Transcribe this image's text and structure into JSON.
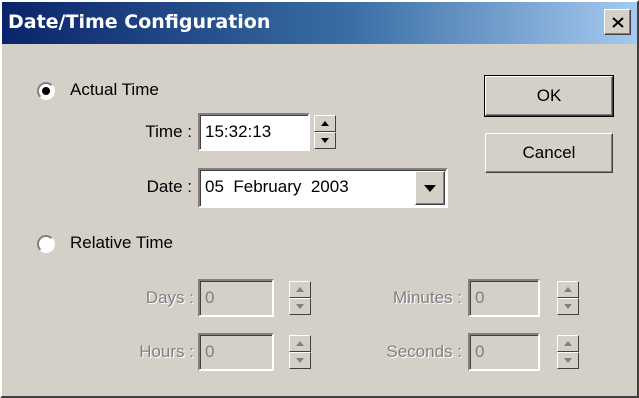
{
  "window": {
    "title": "Date/Time Configuration",
    "close_glyph": "✕"
  },
  "buttons": {
    "ok": "OK",
    "cancel": "Cancel"
  },
  "actual": {
    "label": "Actual Time",
    "selected": true,
    "time_label": "Time :",
    "time_value": "15:32:13",
    "date_label": "Date :",
    "date_value": "05  February  2003"
  },
  "relative": {
    "label": "Relative Time",
    "selected": false,
    "days_label": "Days :",
    "days_value": "0",
    "hours_label": "Hours :",
    "hours_value": "0",
    "minutes_label": "Minutes :",
    "minutes_value": "0",
    "seconds_label": "Seconds :",
    "seconds_value": "0"
  },
  "icons": {
    "close": "close-icon",
    "up": "spin-up-arrow-icon",
    "down": "spin-down-arrow-icon",
    "dropdown": "chevron-down-icon"
  }
}
